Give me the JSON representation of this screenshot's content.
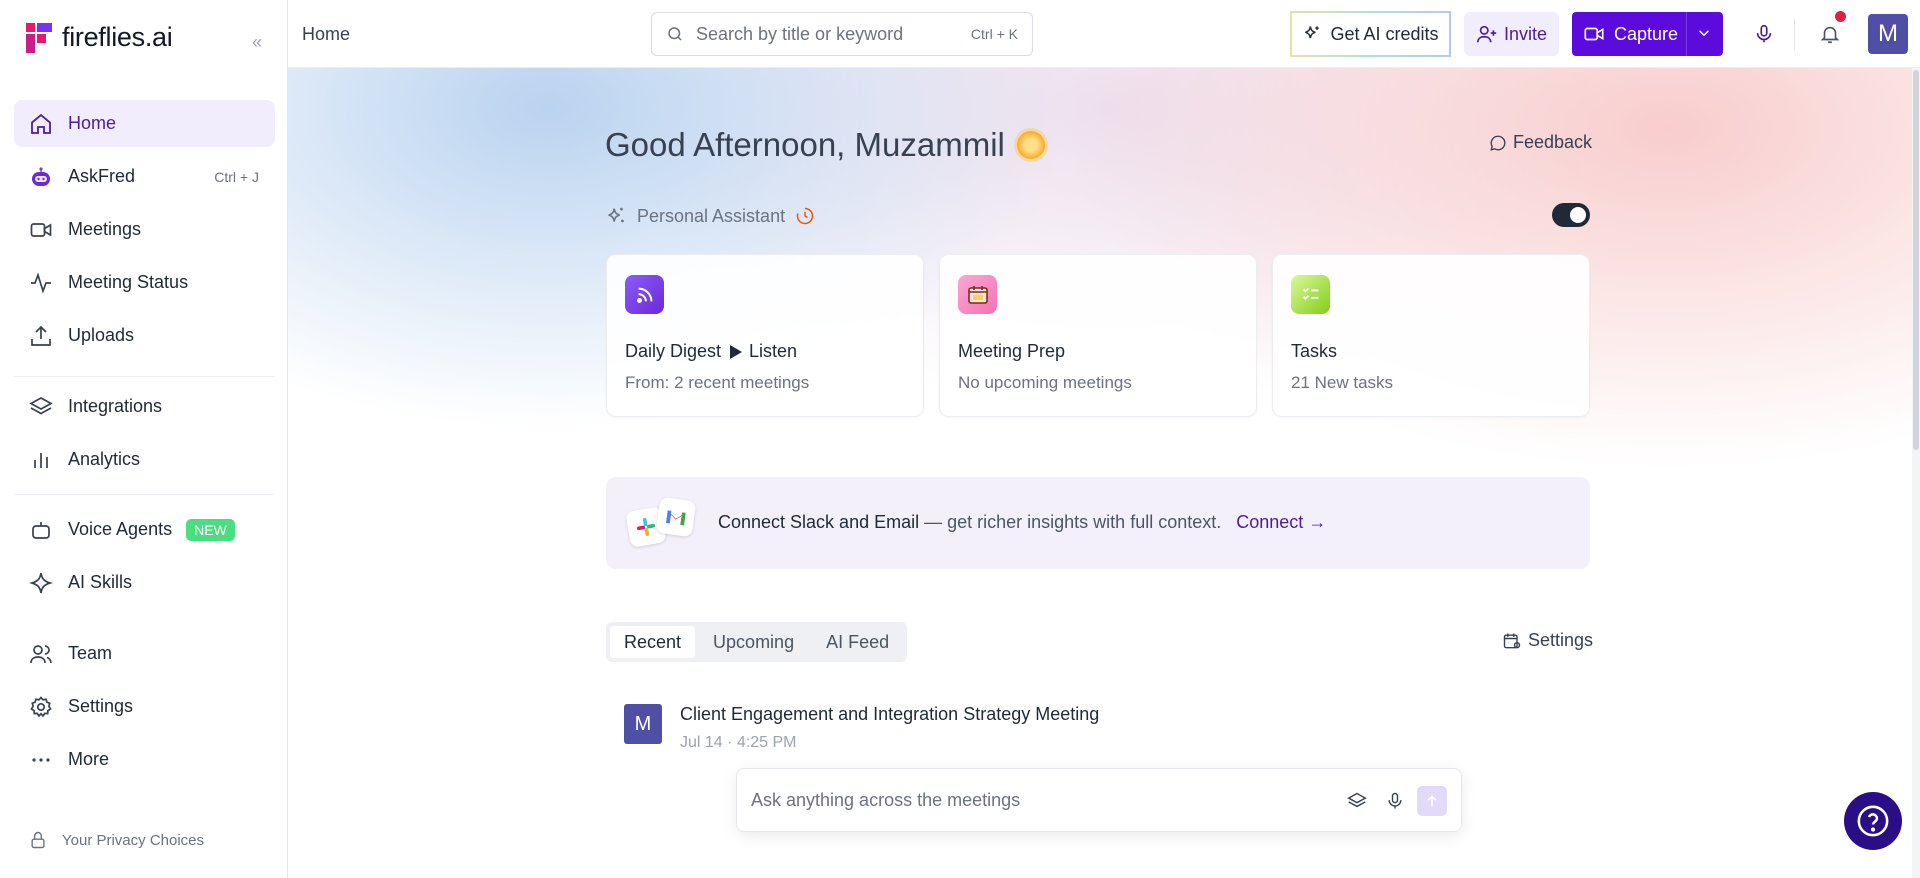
{
  "brand": {
    "name": "fireflies.ai"
  },
  "sidebar": {
    "items": [
      {
        "label": "Home"
      },
      {
        "label": "AskFred",
        "shortcut": "Ctrl + J"
      },
      {
        "label": "Meetings"
      },
      {
        "label": "Meeting Status"
      },
      {
        "label": "Uploads"
      },
      {
        "label": "Integrations"
      },
      {
        "label": "Analytics"
      },
      {
        "label": "Voice Agents",
        "badge": "NEW"
      },
      {
        "label": "AI Skills"
      },
      {
        "label": "Team"
      },
      {
        "label": "Settings"
      },
      {
        "label": "More"
      }
    ],
    "privacy": "Your Privacy Choices"
  },
  "topbar": {
    "breadcrumb": "Home",
    "search_placeholder": "Search by title or keyword",
    "search_shortcut": "Ctrl + K",
    "credits_label": "Get AI credits",
    "invite_label": "Invite",
    "capture_label": "Capture",
    "avatar_initial": "M"
  },
  "main": {
    "greeting": "Good Afternoon, Muzammil",
    "feedback_label": "Feedback",
    "assistant_label": "Personal Assistant",
    "cards": [
      {
        "title": "Daily Digest",
        "action": "Listen",
        "subtitle": "From: 2 recent meetings"
      },
      {
        "title": "Meeting Prep",
        "subtitle": "No upcoming meetings"
      },
      {
        "title": "Tasks",
        "subtitle": "21 New tasks"
      }
    ],
    "banner": {
      "bold": "Connect Slack and Email",
      "text": " — get richer insights with full context.",
      "link": "Connect"
    },
    "tabs": [
      {
        "label": "Recent"
      },
      {
        "label": "Upcoming"
      },
      {
        "label": "AI Feed"
      }
    ],
    "tabs_settings_label": "Settings",
    "meeting": {
      "avatar": "M",
      "title": "Client Engagement and Integration Strategy Meeting",
      "date": "Jul 14",
      "time": "4:25 PM"
    },
    "ask_placeholder": "Ask anything across the meetings"
  },
  "colors": {
    "accent": "#5b0bdc",
    "accent_dark": "#2a0e86",
    "active_bg": "#f1edfd",
    "avatar": "#4f4fa6",
    "badge_new": "#4ade80"
  }
}
